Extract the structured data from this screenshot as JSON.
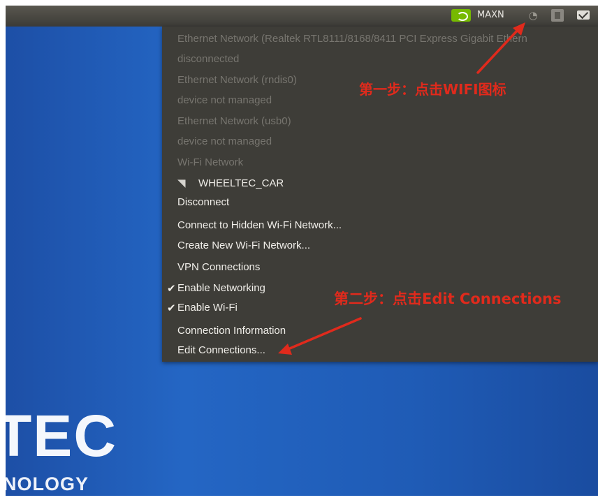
{
  "topbar": {
    "indicator_label": "MAXN",
    "icons": [
      "nvidia-icon",
      "wifi-icon",
      "keyboard-icon",
      "mail-icon"
    ]
  },
  "menu": {
    "items": [
      {
        "label": "Ethernet Network (Realtek RTL8111/8168/8411 PCI Express Gigabit Ethern",
        "dim": true
      },
      {
        "label": "disconnected",
        "dim": true
      },
      {
        "label": "Ethernet Network (rndis0)",
        "dim": true
      },
      {
        "label": "device not managed",
        "dim": true
      },
      {
        "label": "Ethernet Network (usb0)",
        "dim": true
      },
      {
        "label": "device not managed",
        "dim": true
      },
      {
        "label": "Wi-Fi Network",
        "dim": true
      },
      {
        "label": "WHEELTEC_CAR",
        "dim": false,
        "icon": "wifi-signal-icon"
      },
      {
        "label": "Disconnect",
        "dim": false
      },
      {
        "label": "Connect to Hidden Wi-Fi Network...",
        "dim": false
      },
      {
        "label": "Create New Wi-Fi Network...",
        "dim": false
      },
      {
        "label": "VPN Connections",
        "dim": false
      },
      {
        "label": "Enable Networking",
        "dim": false,
        "checked": true
      },
      {
        "label": "Enable Wi-Fi",
        "dim": false,
        "checked": true
      },
      {
        "label": "Connection Information",
        "dim": false
      },
      {
        "label": "Edit Connections...",
        "dim": false
      }
    ]
  },
  "annotations": {
    "step1": "第一步：点击WIFI图标",
    "step2": "第二步：点击Edit Connections",
    "color": "#e02a1c"
  },
  "desktop": {
    "logo_text": "TEC",
    "logo_subtext": "NOLOGY"
  },
  "colors": {
    "desktop_blue": "#2466c4",
    "panel": "#3c3b37",
    "menu_bg": "#3e3d38",
    "nvidia_green": "#76b900"
  }
}
